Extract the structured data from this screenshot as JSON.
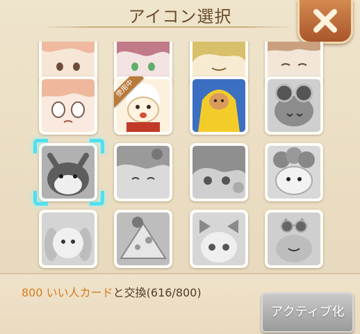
{
  "dialog": {
    "title": "アイコン選択",
    "close_icon": "close-x-icon"
  },
  "icons": [
    {
      "name": "icon-pink-haired-girl",
      "grayscale": false,
      "in_use": false,
      "selected": false
    },
    {
      "name": "icon-green-eyed-girl",
      "grayscale": false,
      "in_use": false,
      "selected": false
    },
    {
      "name": "icon-blonde-character",
      "grayscale": false,
      "in_use": false,
      "selected": false
    },
    {
      "name": "icon-sleepy-character",
      "grayscale": false,
      "in_use": false,
      "selected": false
    },
    {
      "name": "icon-crying-girl",
      "grayscale": false,
      "in_use": false,
      "selected": false
    },
    {
      "name": "icon-sheep",
      "grayscale": false,
      "in_use": true,
      "selected": false
    },
    {
      "name": "icon-raincoat-dog",
      "grayscale": false,
      "in_use": false,
      "selected": false
    },
    {
      "name": "icon-goggles-cat",
      "grayscale": true,
      "in_use": false,
      "selected": false
    },
    {
      "name": "icon-hamster",
      "grayscale": true,
      "in_use": false,
      "selected": true
    },
    {
      "name": "icon-winking-girl",
      "grayscale": true,
      "in_use": false,
      "selected": false
    },
    {
      "name": "icon-flower-girl",
      "grayscale": true,
      "in_use": false,
      "selected": false
    },
    {
      "name": "icon-flower-sheep",
      "grayscale": true,
      "in_use": false,
      "selected": false
    },
    {
      "name": "icon-lop-bunny",
      "grayscale": true,
      "in_use": false,
      "selected": false
    },
    {
      "name": "icon-cheese-cat",
      "grayscale": true,
      "in_use": false,
      "selected": false
    },
    {
      "name": "icon-bow-girl",
      "grayscale": true,
      "in_use": false,
      "selected": false
    },
    {
      "name": "icon-crown-cat",
      "grayscale": true,
      "in_use": false,
      "selected": false
    }
  ],
  "in_use_badge": "使用中",
  "footer": {
    "cost_highlight": "800 いい人カード",
    "cost_rest": "と交換(616/800)",
    "activate_label": "アクティブ化"
  },
  "colors": {
    "accent_orange": "#d67b1e",
    "selection_cyan": "#4fe0ee",
    "close_button": "#c06a3a",
    "disabled_button": "#b0b0b0"
  }
}
